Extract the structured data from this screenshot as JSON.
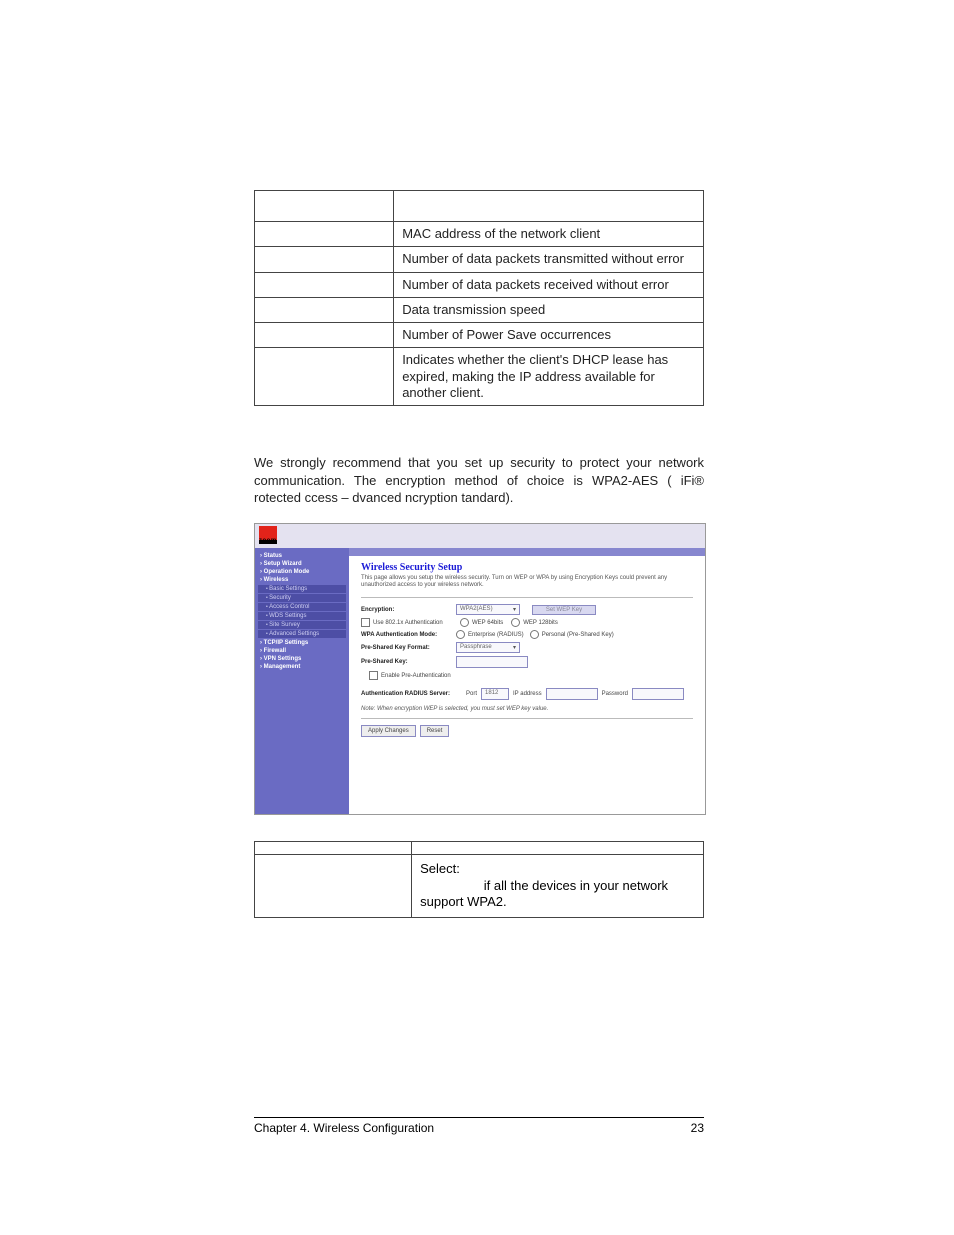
{
  "table1": {
    "rows": [
      "MAC address of the network client",
      "Number of data packets transmitted without error",
      "Number of data packets received without error",
      "Data transmission speed",
      "Number of Power Save occurrences",
      "Indicates whether the client's DHCP lease has expired, making the IP address available for another client."
    ]
  },
  "paragraph": "We strongly recommend that you set up security to protect your network communication. The encryption method of choice is WPA2-AES ( iFi®  rotected  ccess  –  dvanced  ncryption  tandard).",
  "screenshot": {
    "logo": "zoom",
    "sidebar": {
      "top": [
        "Status",
        "Setup Wizard",
        "Operation Mode",
        "Wireless"
      ],
      "subs": [
        "Basic Settings",
        "Security",
        "Access Control",
        "WDS Settings",
        "Site Survey",
        "Advanced Settings"
      ],
      "bottom": [
        "TCP/IP Settings",
        "Firewall",
        "VPN Settings",
        "Management"
      ]
    },
    "title": "Wireless Security Setup",
    "desc": "This page allows you setup the wireless security. Turn on WEP or WPA by using Encryption Keys could prevent any unauthorized access to your wireless network.",
    "fields": {
      "encryption": "Encryption:",
      "encryption_val": "WPA2(AES)",
      "set_btn": "Set WEP Key",
      "use_8021x": "Use 802.1x Authentication",
      "wep64": "WEP 64bits",
      "wep128": "WEP 128bits",
      "wpa_auth_mode": "WPA Authentication Mode:",
      "enterprise": "Enterprise (RADIUS)",
      "personal": "Personal (Pre-Shared Key)",
      "psk_format": "Pre-Shared Key Format:",
      "psk_format_val": "Passphrase",
      "psk": "Pre-Shared Key:",
      "enable_preauth": "Enable Pre-Authentication",
      "radius": "Authentication RADIUS Server:",
      "port": "Port",
      "port_val": "1812",
      "ip": "IP address",
      "password": "Password",
      "note": "Note: When encryption WEP is selected, you must set WEP key value.",
      "apply": "Apply Changes",
      "reset": "Reset"
    }
  },
  "table2": {
    "select": "Select:",
    "row_text": "if all the devices in your network support WPA2."
  },
  "footer": {
    "left": "Chapter 4. Wireless Configuration",
    "right": "23"
  }
}
